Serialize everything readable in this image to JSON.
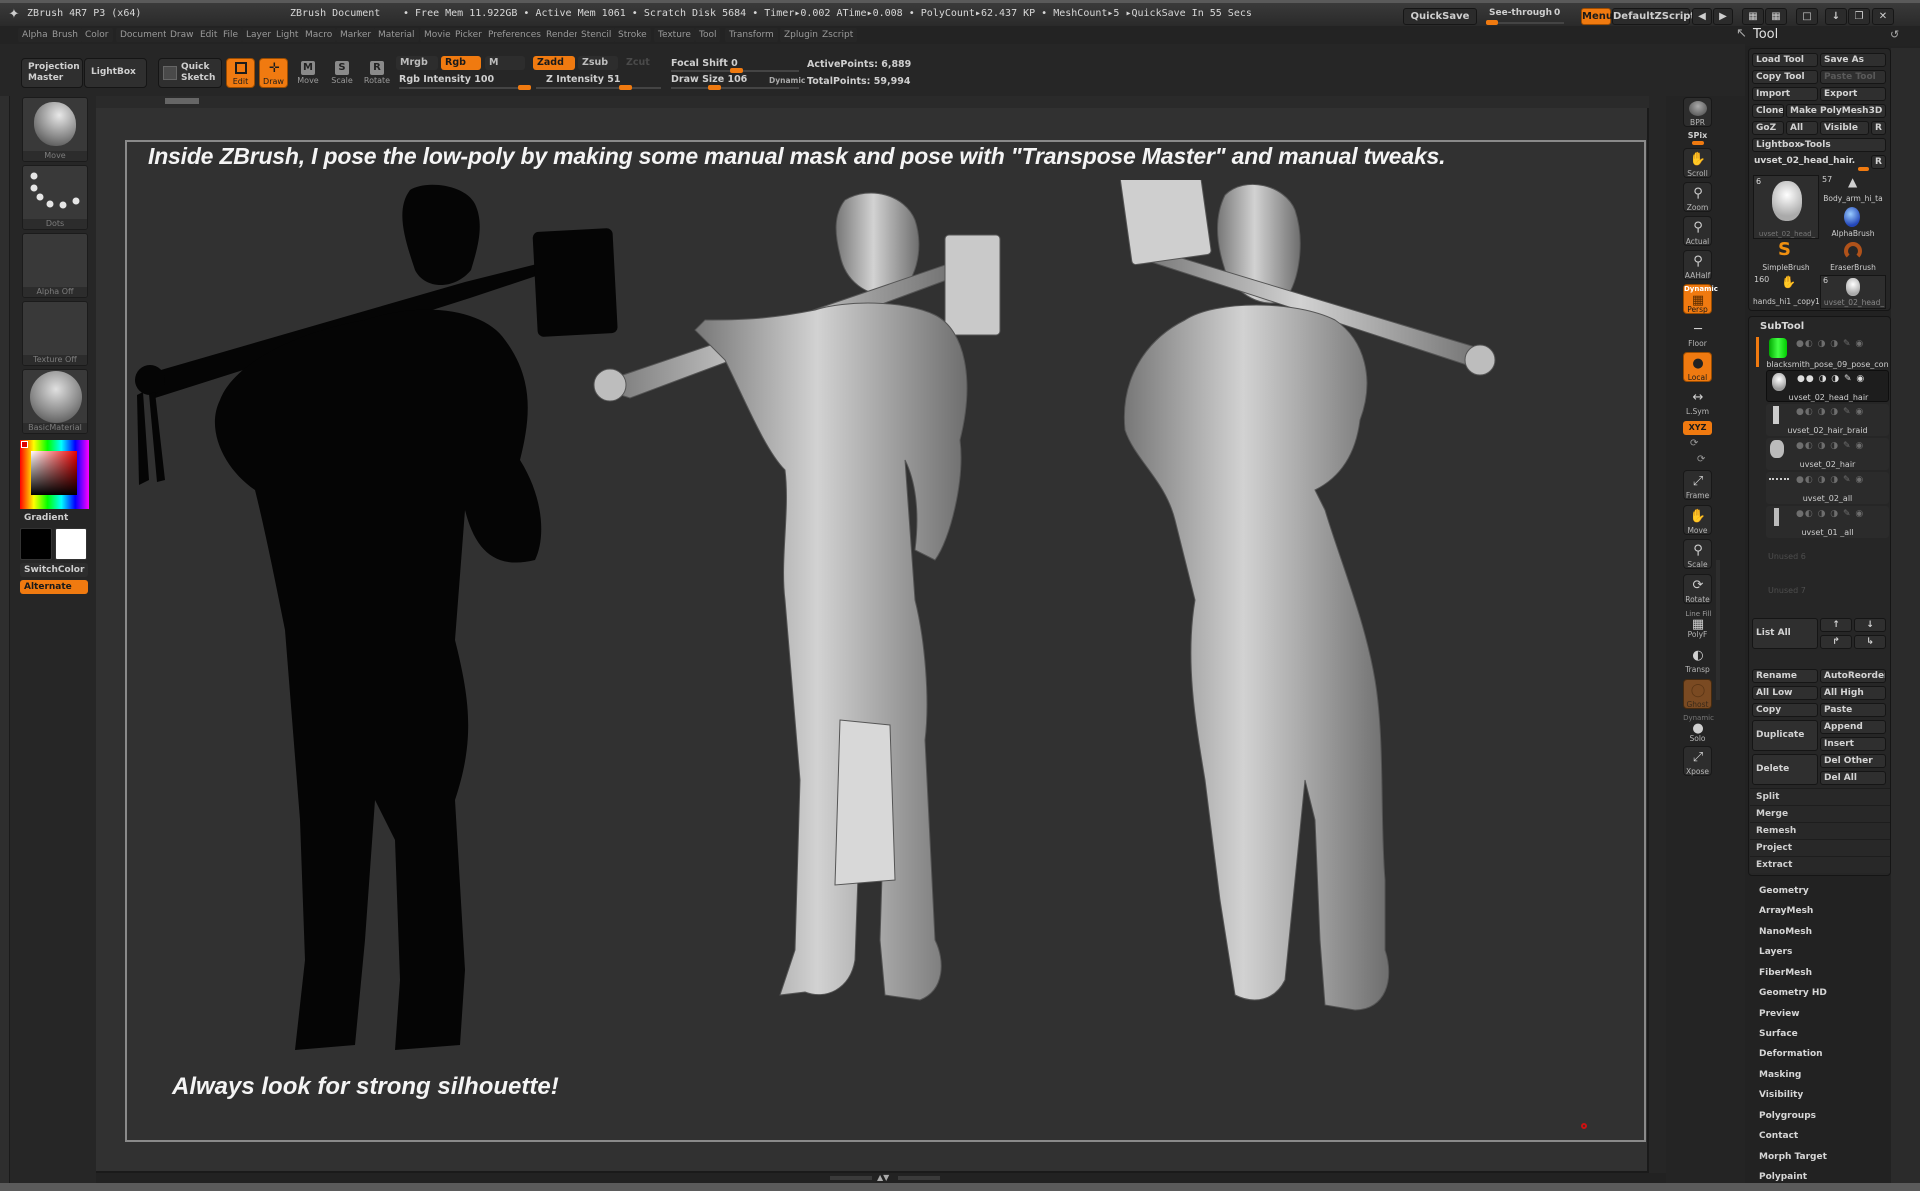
{
  "titlebar": {
    "app_title": "ZBrush 4R7 P3 (x64)",
    "document": "ZBrush Document",
    "status": "• Free Mem 11.922GB • Active Mem 1061 • Scratch Disk 5684 •  Timer▸0.002 ATime▸0.008 • PolyCount▸62.437 KP  • MeshCount▸5   ▸QuickSave In 55 Secs",
    "quicksave": "QuickSave",
    "see_through_label": "See-through",
    "see_through_value": "0",
    "see_through_fraction": 0.0,
    "menus": "Menus",
    "default_zscript": "DefaultZScript"
  },
  "menubar": [
    "Alpha",
    "Brush",
    "Color",
    "Document",
    "Draw",
    "Edit",
    "File",
    "Layer",
    "Light",
    "Macro",
    "Marker",
    "Material",
    "Movie",
    "Picker",
    "Preferences",
    "Render",
    "Stencil",
    "Stroke",
    "Texture",
    "Tool",
    "Transform",
    "Zplugin",
    "Zscript"
  ],
  "toolbar": {
    "projection_master": "Projection Master",
    "lightbox": "LightBox",
    "quick_sketch": "Quick Sketch",
    "edit": "Edit",
    "draw": "Draw",
    "move": "Move",
    "scale": "Scale",
    "rotate": "Rotate",
    "mrgb": "Mrgb",
    "rgb": "Rgb",
    "m": "M",
    "rgb_intensity_label": "Rgb Intensity",
    "rgb_intensity": "100",
    "zadd": "Zadd",
    "zsub": "Zsub",
    "zcut": "Zcut",
    "z_intensity_label": "Z Intensity",
    "z_intensity": "51",
    "focal_shift_label": "Focal Shift",
    "focal_shift": "0",
    "draw_size_label": "Draw Size",
    "draw_size": "106",
    "dynamic": "Dynamic",
    "active_points": "ActivePoints: 6,889",
    "total_points": "TotalPoints: 59,994"
  },
  "left_shelf": {
    "brush": "Move",
    "stroke": "Dots",
    "alpha": "Alpha  Off",
    "texture": "Texture  Off",
    "material": "BasicMaterial",
    "gradient": "Gradient",
    "switch_color": "SwitchColor",
    "alternate": "Alternate",
    "main_color": "#ffffff",
    "secondary_color": "#000000"
  },
  "canvas": {
    "caption_top": "Inside ZBrush, I pose the low-poly by making some manual mask and pose with \"Transpose Master\" and manual tweaks.",
    "caption_bottom": "Always look for strong silhouette!",
    "views": [
      "silhouette",
      "front",
      "back"
    ]
  },
  "right_shelf": [
    {
      "label": "BPR",
      "icon": "bpr-sphere-icon",
      "state": "normal"
    },
    {
      "label": "SPix",
      "icon": "spix-slider-icon",
      "state": "label"
    },
    {
      "label": "Scroll",
      "icon": "hand-icon",
      "state": "normal"
    },
    {
      "label": "Zoom",
      "icon": "zoom-icon",
      "state": "normal"
    },
    {
      "label": "Actual",
      "icon": "actual-icon",
      "state": "normal"
    },
    {
      "label": "AAHalf",
      "icon": "aahalf-icon",
      "state": "normal"
    },
    {
      "label": "Persp",
      "icon": "perspective-grid-icon",
      "state": "orange",
      "top_label": "Dynamic"
    },
    {
      "label": "Floor",
      "icon": "floor-icon",
      "state": "flat"
    },
    {
      "label": "Local",
      "icon": "local-icon",
      "state": "orange"
    },
    {
      "label": "L.Sym",
      "icon": "lsym-icon",
      "state": "flat"
    },
    {
      "label": "XYZ",
      "icon": "xyz-rotate-icon",
      "state": "orange-small"
    },
    {
      "label": "Frame",
      "icon": "frame-icon",
      "state": "normal"
    },
    {
      "label": "Move",
      "icon": "move-hand-icon",
      "state": "normal"
    },
    {
      "label": "Scale",
      "icon": "scale-zoom-icon",
      "state": "normal"
    },
    {
      "label": "Rotate",
      "icon": "rotate-icon",
      "state": "normal"
    },
    {
      "label": "PolyF",
      "icon": "polyframe-icon",
      "state": "flat",
      "top_label": "Line Fill"
    },
    {
      "label": "Transp",
      "icon": "transparency-icon",
      "state": "flat"
    },
    {
      "label": "Ghost",
      "icon": "ghost-icon",
      "state": "dim"
    },
    {
      "label": "Solo",
      "icon": "solo-icon",
      "state": "flat",
      "top_label": "Dynamic"
    },
    {
      "label": "Xpose",
      "icon": "xpose-icon",
      "state": "normal"
    }
  ],
  "tool_panel": {
    "title": "Tool",
    "load_tool": "Load Tool",
    "save_as": "Save As",
    "copy_tool": "Copy Tool",
    "paste_tool": "Paste Tool",
    "import": "Import",
    "export": "Export",
    "clone": "Clone",
    "make_polymesh": "Make PolyMesh3D",
    "goz": "GoZ",
    "all": "All",
    "visible": "Visible",
    "r": "R",
    "lightbox_tools": "Lightbox▸Tools",
    "current_tool": "uvset_02_head_hair.",
    "thumbs": [
      {
        "count": "6",
        "name": "uvset_02_head_",
        "icon": "head-icon"
      },
      {
        "count": "57",
        "name": "Body_arm_hi_ta",
        "icon": "arm-icon"
      },
      {
        "count": "",
        "name": "AlphaBrush",
        "icon": "alphabrush-icon"
      },
      {
        "count": "",
        "name": "SimpleBrush",
        "icon": "simplebrush-icon"
      },
      {
        "count": "",
        "name": "EraserBrush",
        "icon": "eraserbrush-icon"
      },
      {
        "count": "160",
        "name": "hands_hi1 _copy1",
        "icon": "hand-mesh-icon"
      },
      {
        "count": "6",
        "name": "uvset_02_head_",
        "icon": "head-icon"
      }
    ],
    "subtool_title": "SubTool",
    "subtools": [
      {
        "name": "blacksmith_pose_09_pose_con",
        "selected": false
      },
      {
        "name": "uvset_02_head_hair",
        "selected": true
      },
      {
        "name": "uvset_02_hair_braid",
        "selected": false
      },
      {
        "name": "uvset_02_hair",
        "selected": false
      },
      {
        "name": "uvset_02_all",
        "selected": false
      },
      {
        "name": "uvset_01 _all",
        "selected": false
      }
    ],
    "unused": [
      "Unused  6",
      "Unused  7"
    ],
    "list_all": "List All",
    "rename": "Rename",
    "auto_reorder": "AutoReorder",
    "all_low": "All Low",
    "all_high": "All High",
    "copy": "Copy",
    "paste": "Paste",
    "duplicate": "Duplicate",
    "append": "Append",
    "insert": "Insert",
    "delete": "Delete",
    "del_other": "Del Other",
    "del_all": "Del All",
    "sub_rows": [
      "Split",
      "Merge",
      "Remesh",
      "Project",
      "Extract"
    ],
    "sections": [
      "Geometry",
      "ArrayMesh",
      "NanoMesh",
      "Layers",
      "FiberMesh",
      "Geometry HD",
      "Preview",
      "Surface",
      "Deformation",
      "Masking",
      "Visibility",
      "Polygroups",
      "Contact",
      "Morph Target",
      "Polypaint"
    ]
  },
  "colors": {
    "accent": "#f07a10",
    "panel": "#262626",
    "canvas": "#313131"
  }
}
